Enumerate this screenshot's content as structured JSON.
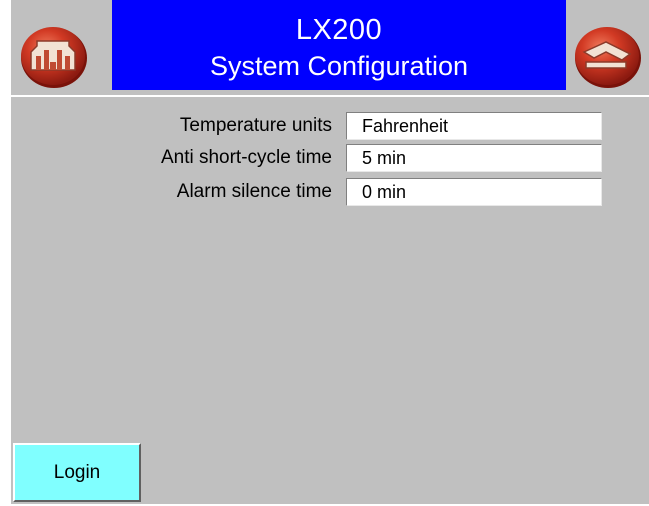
{
  "header": {
    "title_line1": "LX200",
    "title_line2": "System Configuration",
    "home_icon": "building-icon",
    "exit_icon": "exit-arrow-icon"
  },
  "settings": [
    {
      "label": "Temperature units",
      "value": "Fahrenheit"
    },
    {
      "label": "Anti short-cycle time",
      "value": "5 min"
    },
    {
      "label": "Alarm silence time",
      "value": "0 min"
    }
  ],
  "footer": {
    "login_label": "Login"
  },
  "colors": {
    "background": "#c0c0c0",
    "title_band": "#0000ff",
    "title_text": "#ffffff",
    "icon_red": "#cc2a1e",
    "login_button": "#80ffff"
  }
}
